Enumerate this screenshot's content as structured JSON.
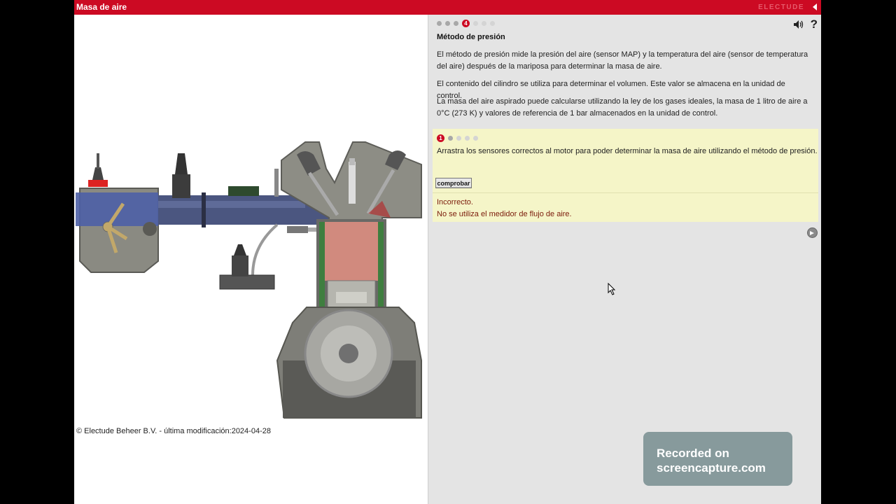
{
  "header": {
    "title": "Masa de aire",
    "brand": "ELECTUDE"
  },
  "left": {
    "copyright": "© Electude Beheer B.V. - última modificación:2024-04-28"
  },
  "right": {
    "steps": {
      "total": 7,
      "current": 4,
      "current_label": "4"
    },
    "section_title": "Método de presión",
    "paragraphs": [
      "El método de presión mide la presión del aire (sensor MAP) y la temperatura del aire (sensor de temperatura del aire) después de la mariposa para determinar la masa de aire.",
      "El contenido del cilindro se utiliza para determinar el volumen. Este valor se almacena en la unidad de control.",
      "La masa del aire aspirado puede calcularse utilizando la ley de los gases ideales, la masa de 1 litro de aire a 0°C (273 K) y valores de referencia de 1 bar almacenados en la unidad de control."
    ],
    "task": {
      "steps_total": 5,
      "current_label": "1",
      "text": "Arrastra los sensores correctos al motor para poder determinar la masa de aire utilizando el método de presión.",
      "check_button": "comprobar",
      "feedback_title": "Incorrecto.",
      "feedback_detail": "No se utiliza el medidor de flujo de aire."
    }
  },
  "watermark": {
    "line1": "Recorded on",
    "line2": "screencapture.com"
  },
  "colors": {
    "accent": "#cc0a23",
    "task_bg": "#f5f5c8",
    "feedback": "#7a1a0a",
    "pane_bg": "#e4e4e4"
  },
  "icons": [
    "back-arrow-icon",
    "sound-icon",
    "help-icon",
    "next-arrow-icon",
    "mouse-cursor-icon"
  ]
}
